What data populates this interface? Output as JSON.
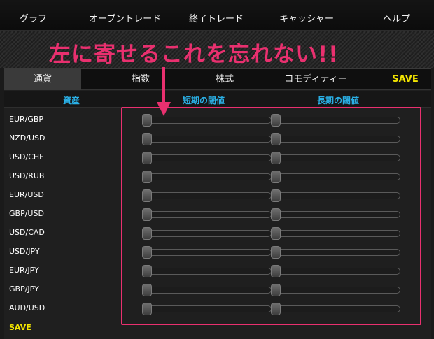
{
  "topnav": {
    "items": [
      "グラフ",
      "オープントレード",
      "終了トレード",
      "キャッシャー",
      "ヘルプ"
    ]
  },
  "annotation": {
    "text": "左に寄せるこれを忘れない!!",
    "color": "#e9306f"
  },
  "tabs": {
    "items": [
      "通貨",
      "指数",
      "株式",
      "コモディティー"
    ],
    "active": "通貨",
    "save_label": "SAVE"
  },
  "columns": {
    "asset": "資産",
    "short_threshold": "短期の閾値",
    "long_threshold": "長期の閾値"
  },
  "rows": [
    {
      "asset": "EUR/GBP",
      "short_value": 0,
      "long_value": 0
    },
    {
      "asset": "NZD/USD",
      "short_value": 0,
      "long_value": 0
    },
    {
      "asset": "USD/CHF",
      "short_value": 0,
      "long_value": 0
    },
    {
      "asset": "USD/RUB",
      "short_value": 0,
      "long_value": 0
    },
    {
      "asset": "EUR/USD",
      "short_value": 0,
      "long_value": 0
    },
    {
      "asset": "GBP/USD",
      "short_value": 0,
      "long_value": 0
    },
    {
      "asset": "USD/CAD",
      "short_value": 0,
      "long_value": 0
    },
    {
      "asset": "USD/JPY",
      "short_value": 0,
      "long_value": 0
    },
    {
      "asset": "EUR/JPY",
      "short_value": 0,
      "long_value": 0
    },
    {
      "asset": "GBP/JPY",
      "short_value": 0,
      "long_value": 0
    },
    {
      "asset": "AUD/USD",
      "short_value": 0,
      "long_value": 0
    }
  ],
  "footer": {
    "save_label": "SAVE"
  },
  "colors": {
    "accent_blue": "#2ab0e6",
    "save_yellow": "#f2e400",
    "highlight_pink": "#e9306f"
  }
}
